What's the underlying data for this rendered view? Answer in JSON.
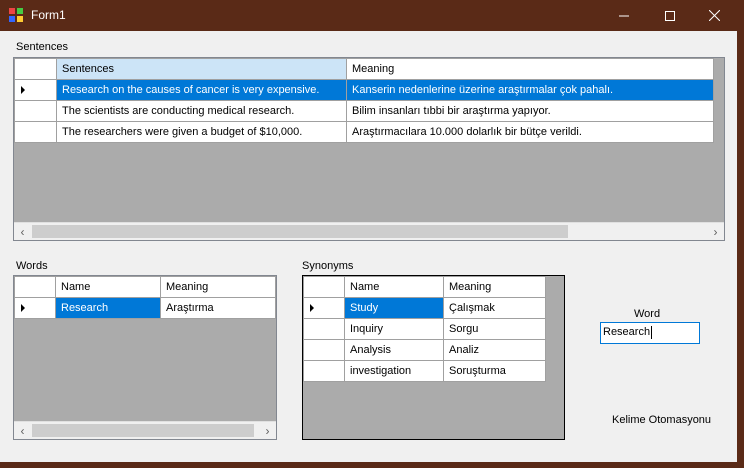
{
  "window": {
    "title": "Form1",
    "min_icon": "minimize-icon",
    "max_icon": "maximize-icon",
    "close_icon": "close-icon"
  },
  "sentences": {
    "label": "Sentences",
    "columns": [
      "Sentences",
      "Meaning"
    ],
    "rows": [
      [
        "Research on the causes of cancer is very expensive.",
        "Kanserin nedenlerine üzerine araştırmalar çok pahalı."
      ],
      [
        "The scientists are conducting medical research.",
        "Bilim insanları tıbbi bir araştırma yapıyor."
      ],
      [
        "The researchers were given a budget of $10,000.",
        "Araştırmacılara 10.000 dolarlık bir bütçe verildi."
      ]
    ]
  },
  "words": {
    "label": "Words",
    "columns": [
      "Name",
      "Meaning"
    ],
    "rows": [
      [
        "Research",
        "Araştırma"
      ]
    ]
  },
  "synonyms": {
    "label": "Synonyms",
    "columns": [
      "Name",
      "Meaning"
    ],
    "rows": [
      [
        "Study",
        "Çalışmak"
      ],
      [
        "Inquiry",
        "Sorgu"
      ],
      [
        "Analysis",
        "Analiz"
      ],
      [
        "investigation",
        "Soruşturma"
      ]
    ]
  },
  "word_field": {
    "label": "Word",
    "value": "Research"
  },
  "footer_label": "Kelime Otomasyonu",
  "colors": {
    "titlebar": "#5a2a17",
    "selection": "#0078d7",
    "grid_bg": "#ababab"
  }
}
